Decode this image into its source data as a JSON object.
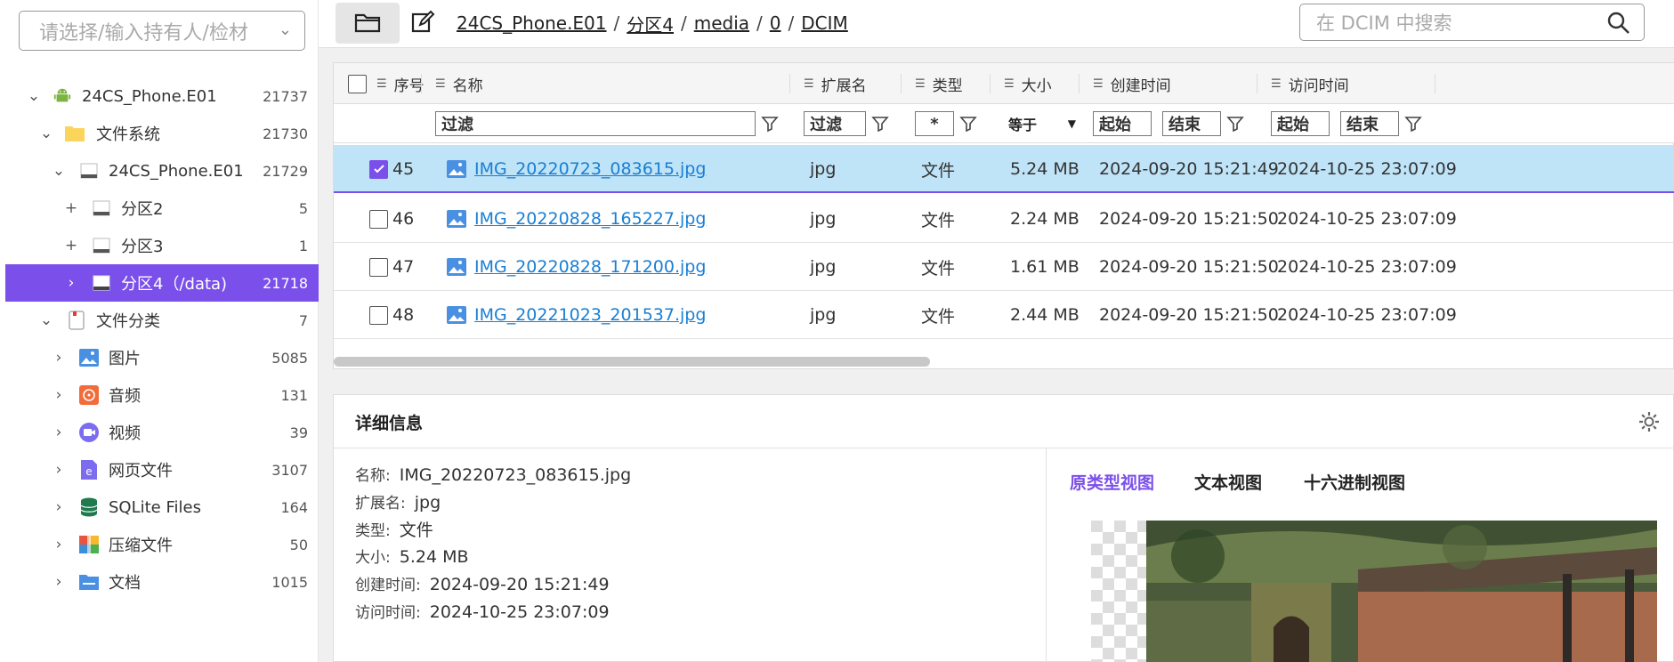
{
  "owner_select": {
    "placeholder": "请选择/输入持有人/检材"
  },
  "tree": [
    {
      "label": "24CS_Phone.E01",
      "count": "21737",
      "toggle": "⌄",
      "icon": "android-icon"
    },
    {
      "label": "文件系统",
      "count": "21730",
      "toggle": "⌄",
      "icon": "folder-icon"
    },
    {
      "label": "24CS_Phone.E01",
      "count": "21729",
      "toggle": "⌄",
      "icon": "disk-icon"
    },
    {
      "label": "分区2",
      "count": "5",
      "toggle": "+",
      "icon": "disk-icon"
    },
    {
      "label": "分区3",
      "count": "1",
      "toggle": "+",
      "icon": "disk-icon"
    },
    {
      "label": "分区4（/data)",
      "count": "21718",
      "toggle": "›",
      "icon": "disk-icon"
    },
    {
      "label": "文件分类",
      "count": "7",
      "toggle": "⌄",
      "icon": "category-icon"
    },
    {
      "label": "图片",
      "count": "5085",
      "toggle": "›",
      "icon": "image-icon"
    },
    {
      "label": "音频",
      "count": "131",
      "toggle": "›",
      "icon": "audio-icon"
    },
    {
      "label": "视频",
      "count": "39",
      "toggle": "›",
      "icon": "video-icon"
    },
    {
      "label": "网页文件",
      "count": "3107",
      "toggle": "›",
      "icon": "web-icon"
    },
    {
      "label": "SQLite Files",
      "count": "164",
      "toggle": "›",
      "icon": "database-icon"
    },
    {
      "label": "压缩文件",
      "count": "50",
      "toggle": "›",
      "icon": "archive-icon"
    },
    {
      "label": "文档",
      "count": "1015",
      "toggle": "›",
      "icon": "document-icon"
    }
  ],
  "breadcrumb": [
    "24CS_Phone.E01",
    "分区4",
    "media",
    "0",
    "DCIM"
  ],
  "search": {
    "placeholder": "在 DCIM 中搜索"
  },
  "table": {
    "columns": {
      "index": "序号",
      "name": "名称",
      "ext": "扩展名",
      "type": "类型",
      "size": "大小",
      "created": "创建时间",
      "accessed": "访问时间"
    },
    "filters": {
      "name": "过滤",
      "ext": "过滤",
      "type": "*",
      "size": "等于",
      "created_start": "起始",
      "created_end": "结束",
      "accessed_start": "起始",
      "accessed_end": "结束"
    },
    "rows": [
      {
        "index": "45",
        "name": "IMG_20220723_083615.jpg",
        "ext": "jpg",
        "type": "文件",
        "size": "5.24 MB",
        "created": "2024-09-20 15:21:49",
        "accessed": "2024-10-25 23:07:09",
        "checked": true
      },
      {
        "index": "46",
        "name": "IMG_20220828_165227.jpg",
        "ext": "jpg",
        "type": "文件",
        "size": "2.24 MB",
        "created": "2024-09-20 15:21:50",
        "accessed": "2024-10-25 23:07:09",
        "checked": false
      },
      {
        "index": "47",
        "name": "IMG_20220828_171200.jpg",
        "ext": "jpg",
        "type": "文件",
        "size": "1.61 MB",
        "created": "2024-09-20 15:21:50",
        "accessed": "2024-10-25 23:07:09",
        "checked": false
      },
      {
        "index": "48",
        "name": "IMG_20221023_201537.jpg",
        "ext": "jpg",
        "type": "文件",
        "size": "2.44 MB",
        "created": "2024-09-20 15:21:50",
        "accessed": "2024-10-25 23:07:09",
        "checked": false
      }
    ]
  },
  "details": {
    "title": "详细信息",
    "fields": [
      {
        "key": "名称:",
        "value": "IMG_20220723_083615.jpg"
      },
      {
        "key": "扩展名:",
        "value": "jpg"
      },
      {
        "key": "类型:",
        "value": "文件"
      },
      {
        "key": "大小:",
        "value": "5.24 MB"
      },
      {
        "key": "创建时间:",
        "value": "2024-09-20 15:21:49"
      },
      {
        "key": "访问时间:",
        "value": "2024-10-25 23:07:09"
      }
    ],
    "view_tabs": [
      "原类型视图",
      "文本视图",
      "十六进制视图"
    ]
  },
  "colors": {
    "accent": "#7b4fe9",
    "selected_row": "#bfe3f7",
    "link": "#1a7fd4"
  }
}
